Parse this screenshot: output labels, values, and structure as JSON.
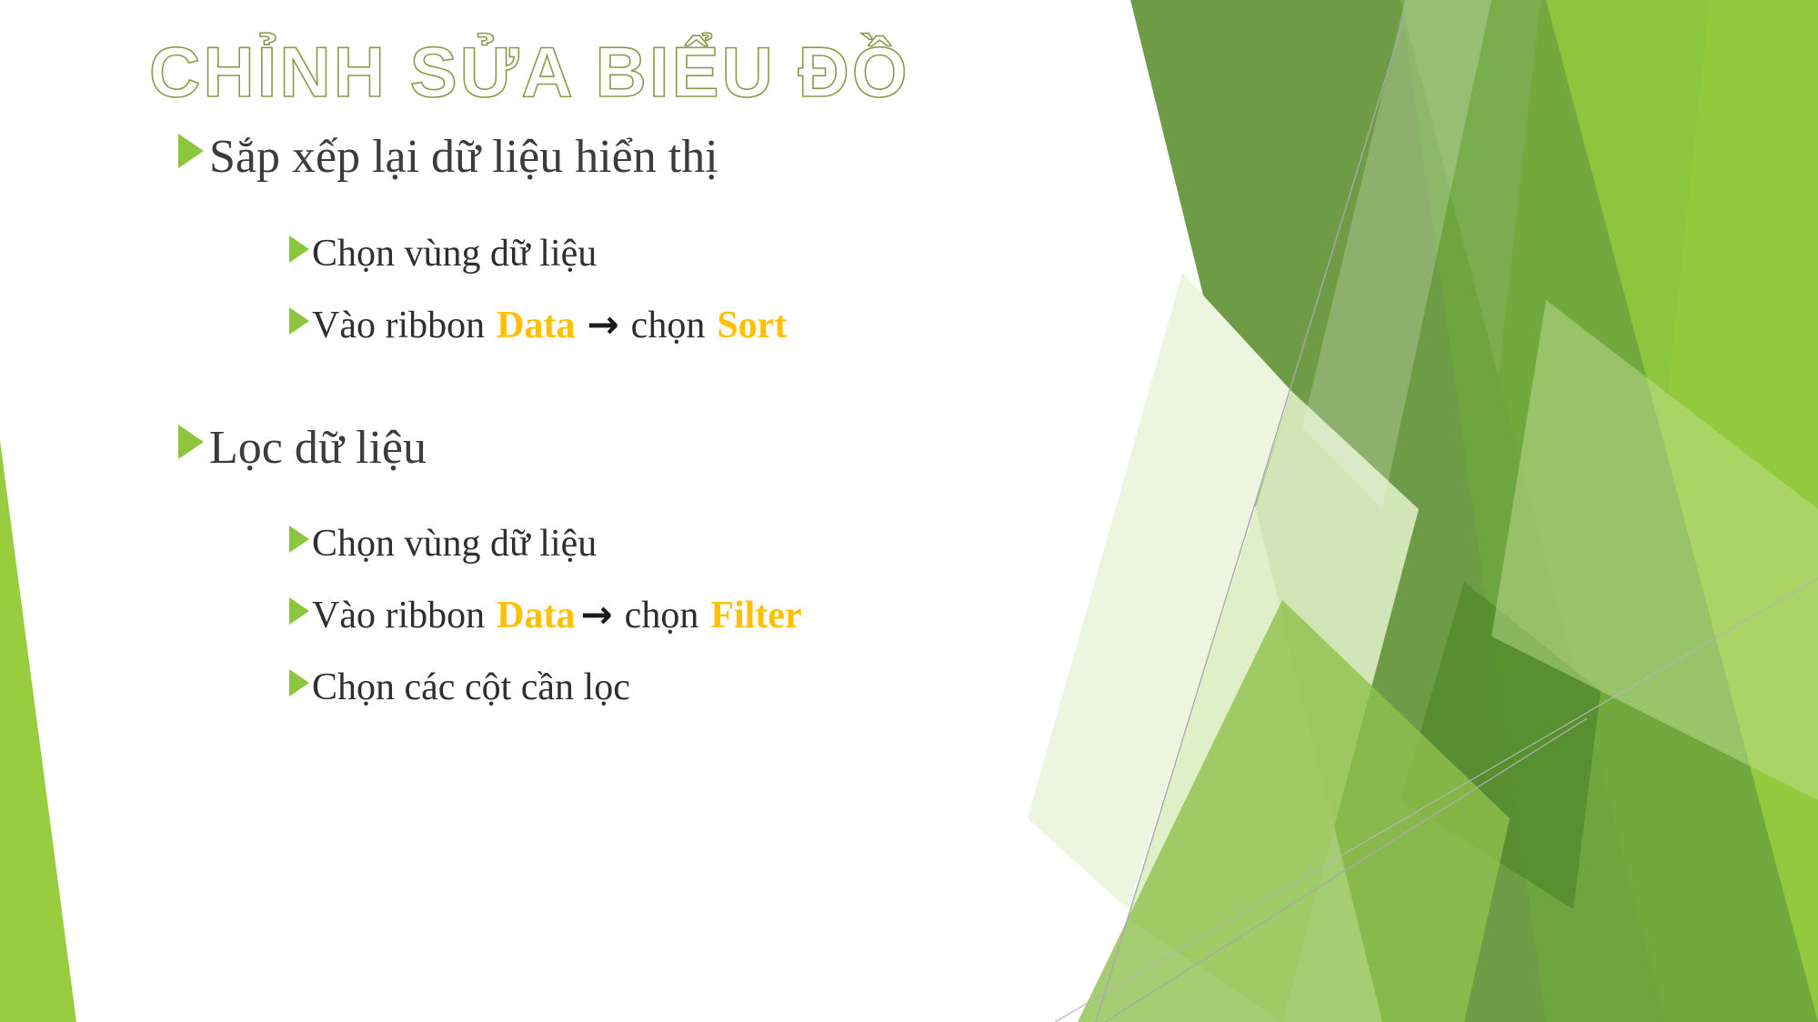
{
  "slide": {
    "title": "CHỈNH SỬA BIỂU ĐỒ",
    "background_color": "#FFFFFF",
    "title_outline_color": "#8A9A4C",
    "bullet_marker_color": "#8CC63F",
    "accent_color": "#FFC000",
    "body_text_color": "#3C3C3C"
  },
  "content": {
    "sections": [
      {
        "heading": "Sắp xếp lại dữ liệu hiển thị",
        "items": [
          {
            "text": "Chọn vùng dữ liệu"
          },
          {
            "prefix": "Vào ribbon",
            "keyword1": "Data",
            "arrow": "→",
            "middle": "chọn",
            "keyword2": "Sort"
          }
        ]
      },
      {
        "heading": "Lọc dữ liệu",
        "items": [
          {
            "text": "Chọn vùng dữ liệu"
          },
          {
            "prefix": "Vào ribbon",
            "keyword1": "Data",
            "arrow": "→",
            "middle": "chọn",
            "keyword2": "Filter"
          },
          {
            "text": "Chọn các cột cần lọc"
          }
        ]
      }
    ]
  },
  "theme": {
    "greens": {
      "bright": "#8CC63F",
      "lime": "#97CC3E",
      "mid": "#76B043",
      "dark": "#6E9B45",
      "deep": "#5E9139",
      "pale": "#D9EBB9",
      "palest": "#EDF5DE",
      "hairline": "#B9B9B9"
    }
  }
}
